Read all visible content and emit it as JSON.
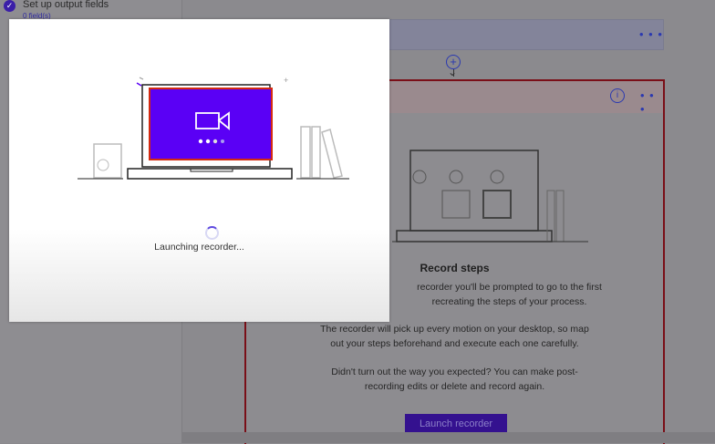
{
  "sidebar": {
    "step": {
      "title": "Set up output fields",
      "subtitle": "0 field(s)"
    }
  },
  "flow": {
    "more_label": "• • •",
    "info_label": "i",
    "add_label": "+"
  },
  "record": {
    "title": "Record steps",
    "para1": [
      "recorder you'll be prompted to go to the first",
      "recreating the steps of your process."
    ],
    "para2": [
      "The recorder will pick up every motion on your desktop, so map",
      "out your steps beforehand and execute each one carefully."
    ],
    "para3": [
      "Didn't turn out the way you expected? You can make post-",
      "recording edits or delete and record again."
    ],
    "button": "Launch recorder"
  },
  "modal": {
    "status": "Launching recorder..."
  },
  "colors": {
    "accent": "#5a00f5",
    "border": "#7a0f18"
  }
}
